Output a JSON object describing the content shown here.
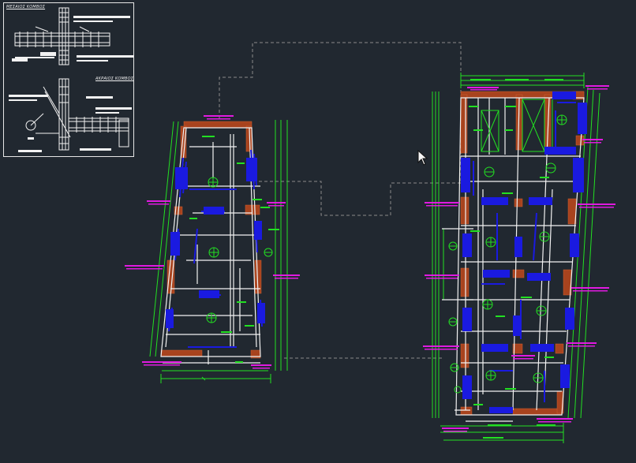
{
  "drawing": {
    "detail_panel": {
      "title_middle": "ΜΕΣΑΙΟΣ ΚΟΜΒΟΣ",
      "title_end": "ΑΚΡΑΙΟΣ ΚΟΜΒΟΣ"
    }
  },
  "colors": {
    "background": "#212830",
    "rebar_white": "#f2f2f2",
    "rebar_blue": "#1a1ae0",
    "dimension_green": "#22e022",
    "annotation_magenta": "#e01ae0",
    "column_brown": "#a8431e",
    "outline_grey": "#8a8a8a"
  },
  "icons": {
    "cursor": "arrow-cursor-icon"
  }
}
